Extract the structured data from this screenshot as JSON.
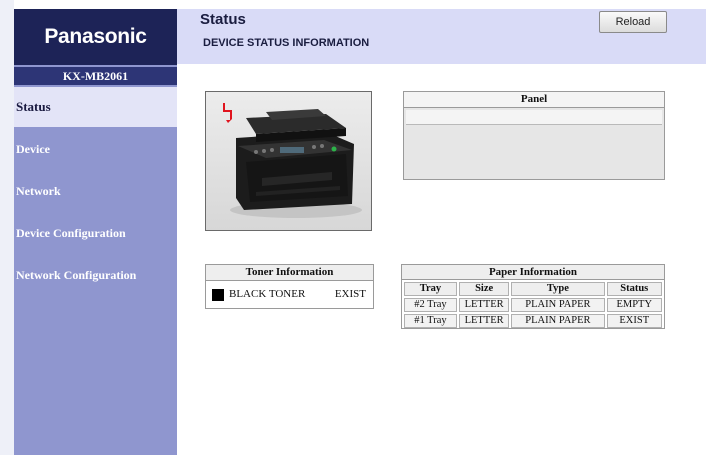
{
  "sidebar": {
    "brand": "Panasonic",
    "model": "KX-MB2061",
    "items": [
      {
        "label": "Status",
        "active": true
      },
      {
        "label": "Device"
      },
      {
        "label": "Network"
      },
      {
        "label": "Device Configuration"
      },
      {
        "label": "Network Configuration"
      }
    ]
  },
  "header": {
    "title": "Status",
    "subtitle": "DEVICE STATUS INFORMATION",
    "reload_label": "Reload"
  },
  "device_image": {
    "alert_icon": "red-lightning-alert-icon"
  },
  "panel": {
    "title": "Panel"
  },
  "toner": {
    "title": "Toner Information",
    "row": {
      "name": "BLACK TONER",
      "status": "EXIST",
      "swatch_color": "#000000"
    }
  },
  "paper": {
    "title": "Paper Information",
    "headers": [
      "Tray",
      "Size",
      "Type",
      "Status"
    ],
    "rows": [
      [
        "#2 Tray",
        "LETTER",
        "PLAIN PAPER",
        "EMPTY"
      ],
      [
        "#1 Tray",
        "LETTER",
        "PLAIN PAPER",
        "EXIST"
      ]
    ]
  },
  "colors": {
    "sidebar": "#8f96cf",
    "logo_bg": "#1d2357",
    "header_bg": "#d9dbf7",
    "alert": "#e0141e"
  }
}
